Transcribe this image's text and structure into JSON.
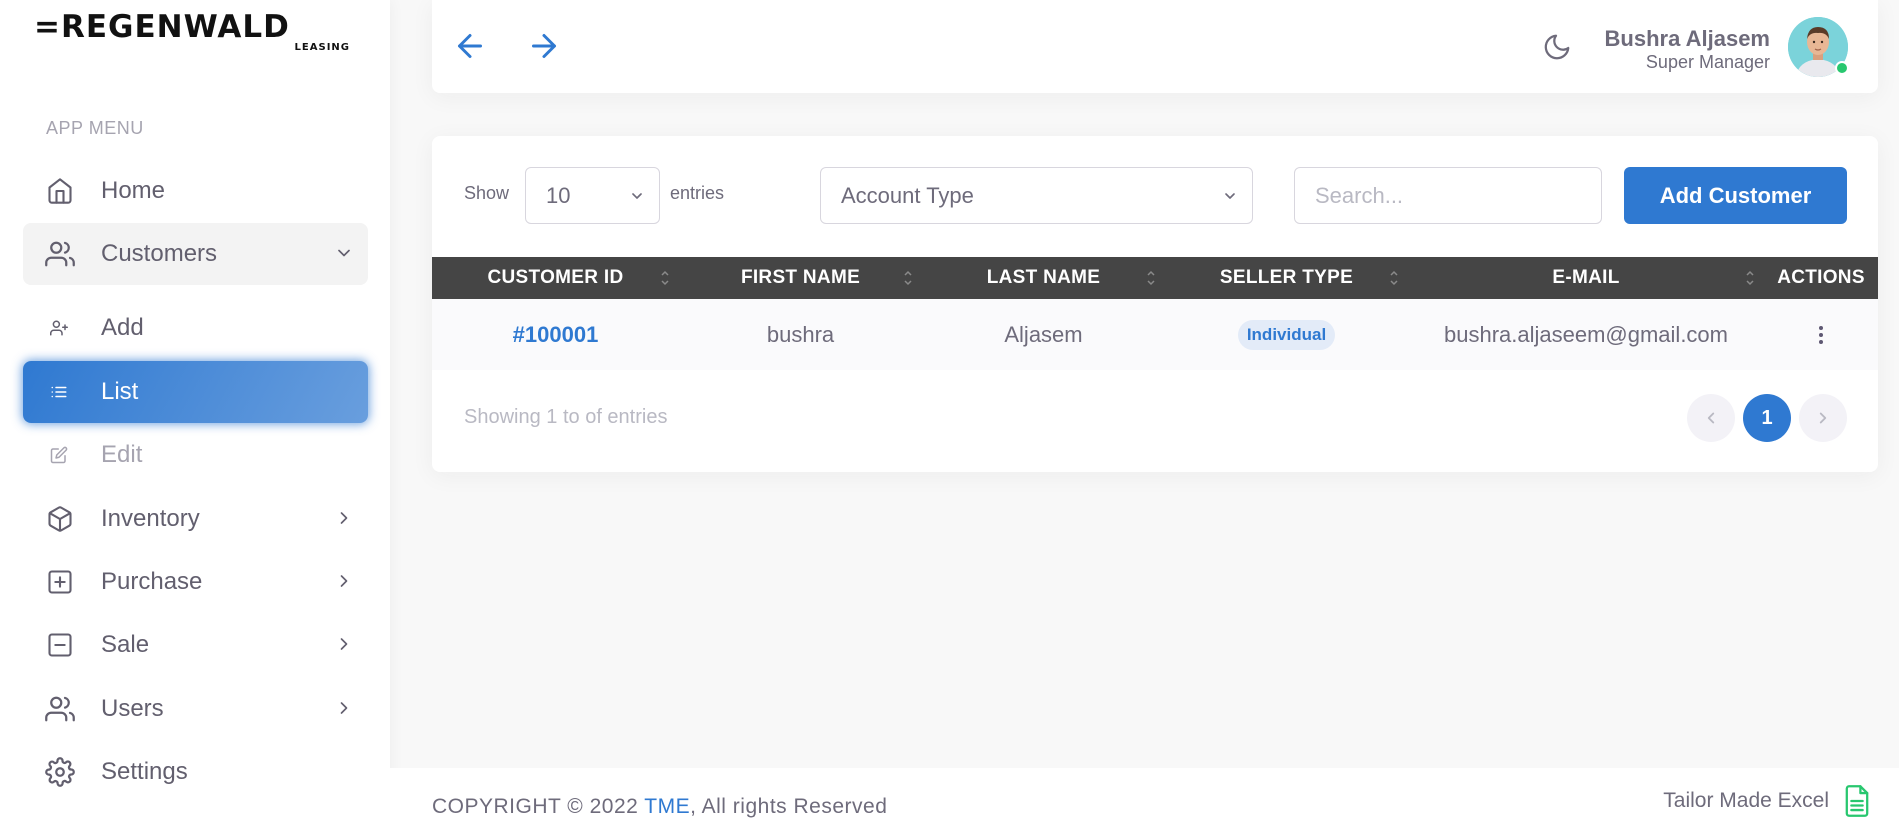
{
  "brand": {
    "name": "=REGENWALD",
    "sub": "LEASING"
  },
  "sidebar": {
    "header": "APP MENU",
    "items": [
      {
        "label": "Home",
        "icon": "home-icon"
      },
      {
        "label": "Customers",
        "icon": "users-icon",
        "expanded": true
      },
      {
        "label": "Add",
        "icon": "user-plus-icon"
      },
      {
        "label": "List",
        "icon": "list-icon",
        "active": true
      },
      {
        "label": "Edit",
        "icon": "edit-icon"
      },
      {
        "label": "Inventory",
        "icon": "box-icon"
      },
      {
        "label": "Purchase",
        "icon": "plus-square-icon"
      },
      {
        "label": "Sale",
        "icon": "minus-square-icon"
      },
      {
        "label": "Users",
        "icon": "users-icon"
      },
      {
        "label": "Settings",
        "icon": "gear-icon"
      }
    ]
  },
  "navbar": {
    "user_name": "Bushra Aljasem",
    "user_role": "Super Manager",
    "status": "online"
  },
  "toolbar": {
    "show_label": "Show",
    "entries_value": "10",
    "entries_label": "entries",
    "account_type_placeholder": "Account Type",
    "search_placeholder": "Search...",
    "add_button": "Add Customer"
  },
  "table": {
    "columns": [
      "CUSTOMER ID",
      "FIRST NAME",
      "LAST NAME",
      "SELLER TYPE",
      "E-MAIL",
      "ACTIONS"
    ],
    "rows": [
      {
        "id": "#100001",
        "first_name": "bushra",
        "last_name": "Aljasem",
        "seller_type": "Individual",
        "email": "bushra.aljaseem@gmail.com"
      }
    ]
  },
  "pagination": {
    "info": "Showing 1 to of entries",
    "current_page": "1"
  },
  "footer": {
    "copyright_prefix": "COPYRIGHT © 2022",
    "copyright_link": "TME",
    "copyright_suffix": ", All rights Reserved",
    "right_text": "Tailor Made Excel"
  },
  "colors": {
    "primary": "#2f79d1",
    "header_bg": "#454545",
    "online": "#28c76f",
    "excel": "#28c76f"
  }
}
